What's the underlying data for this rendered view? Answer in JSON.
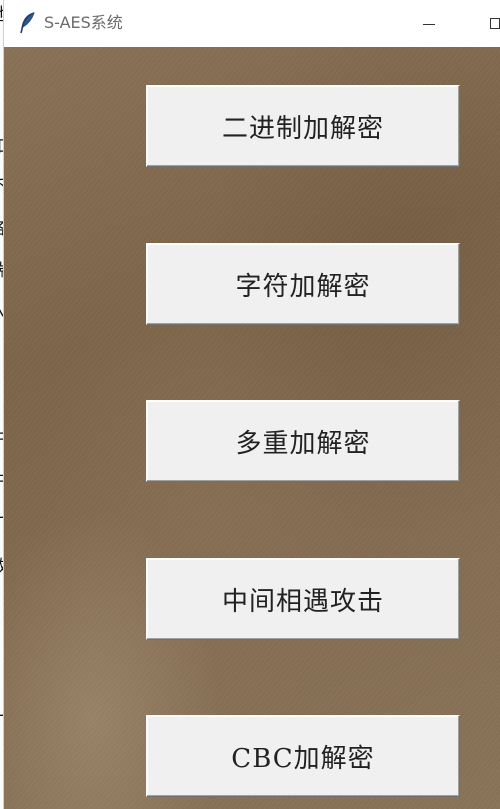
{
  "window": {
    "title": "S-AES系统",
    "icon": "feather-icon",
    "controls": {
      "minimize": "minimize-icon",
      "maximize": "maximize-icon"
    }
  },
  "background": {
    "style": "brown-paper-texture",
    "color": "#7d6549"
  },
  "menu": {
    "buttons": [
      {
        "id": "binary",
        "label": "二进制加解密"
      },
      {
        "id": "char",
        "label": "字符加解密"
      },
      {
        "id": "multi",
        "label": "多重加解密"
      },
      {
        "id": "mitm",
        "label": "中间相遇攻击"
      },
      {
        "id": "cbc",
        "label": "CBC加解密"
      }
    ]
  },
  "behind_window_text": [
    "地",
    "如",
    "不",
    "各",
    "湍",
    "入",
    "中",
    "于",
    "厂",
    "数",
    "厂"
  ]
}
